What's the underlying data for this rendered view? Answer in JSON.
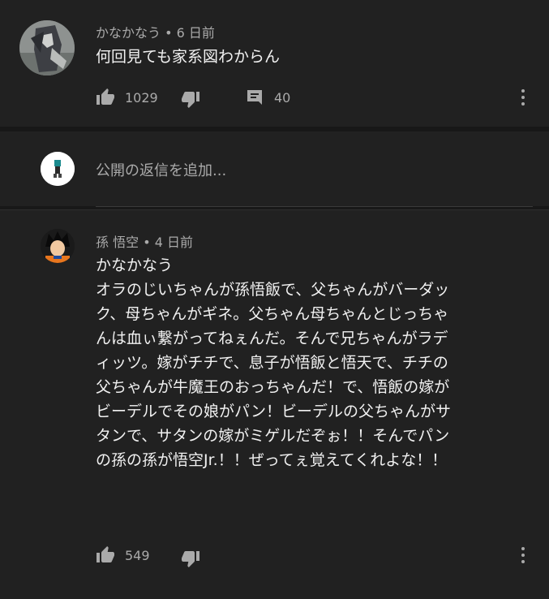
{
  "comment": {
    "author": "かなかなう",
    "separator": "•",
    "time": "6 日前",
    "text": "何回見ても家系図わからん",
    "likes": "1029",
    "replies": "40"
  },
  "reply_box": {
    "placeholder": "公開の返信を追加..."
  },
  "reply": {
    "author": "孫 悟空",
    "separator": "•",
    "time": "4 日前",
    "mention": "かなかなう",
    "lines": [
      "オラのじいちゃんが孫悟飯で、父ちゃんがバーダッ",
      "ク、母ちゃんがギネ。父ちゃん母ちゃんとじっちゃ",
      "んは血ぃ繋がってねぇんだ。そんで兄ちゃんがラデ",
      "ィッツ。嫁がチチで、息子が悟飯と悟天で、チチの",
      "父ちゃんが牛魔王のおっちゃんだ！で、悟飯の嫁が",
      "ビーデルでその娘がパン！ビーデルの父ちゃんがサ",
      "タンで、サタンの嫁がミゲルだぞぉ！！そんでパン",
      "の孫の孫が悟空Jr.！！ぜってぇ覚えてくれよな！！"
    ],
    "likes": "549"
  },
  "colors": {
    "background": "#181818",
    "panel": "#212121",
    "text_primary": "#f1f1f1",
    "text_secondary": "#aaaaaa"
  }
}
